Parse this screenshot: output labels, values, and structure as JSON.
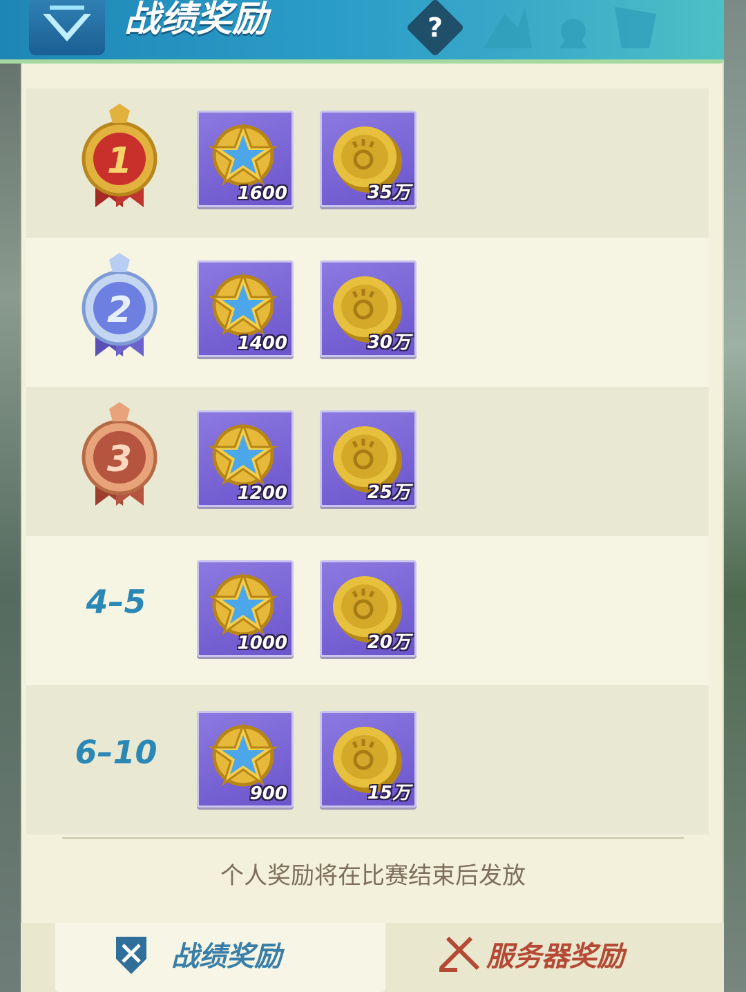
{
  "header": {
    "title": "战绩奖励",
    "help_symbol": "?"
  },
  "ranks": [
    {
      "type": "medal",
      "medal_label": "1",
      "medal_color": "#c9302c",
      "rewards": [
        {
          "icon": "star-badge-icon",
          "count": "1600"
        },
        {
          "icon": "paw-coin-icon",
          "count": "35万"
        }
      ]
    },
    {
      "type": "medal",
      "medal_label": "2",
      "medal_color": "#6d7fe0",
      "rewards": [
        {
          "icon": "star-badge-icon",
          "count": "1400"
        },
        {
          "icon": "paw-coin-icon",
          "count": "30万"
        }
      ]
    },
    {
      "type": "medal",
      "medal_label": "3",
      "medal_color": "#b5553f",
      "rewards": [
        {
          "icon": "star-badge-icon",
          "count": "1200"
        },
        {
          "icon": "paw-coin-icon",
          "count": "25万"
        }
      ]
    },
    {
      "type": "text",
      "label": "4–5",
      "rewards": [
        {
          "icon": "star-badge-icon",
          "count": "1000"
        },
        {
          "icon": "paw-coin-icon",
          "count": "20万"
        }
      ]
    },
    {
      "type": "text",
      "label": "6–10",
      "rewards": [
        {
          "icon": "star-badge-icon",
          "count": "900"
        },
        {
          "icon": "paw-coin-icon",
          "count": "15万"
        }
      ]
    }
  ],
  "footer_note": "个人奖励将在比赛结束后发放",
  "tabs": {
    "record_rewards": "战绩奖励",
    "server_rewards": "服务器奖励"
  },
  "colors": {
    "accent_blue": "#2b87b5",
    "item_bg": "#7c67d6",
    "server_tab": "#b44a35"
  }
}
